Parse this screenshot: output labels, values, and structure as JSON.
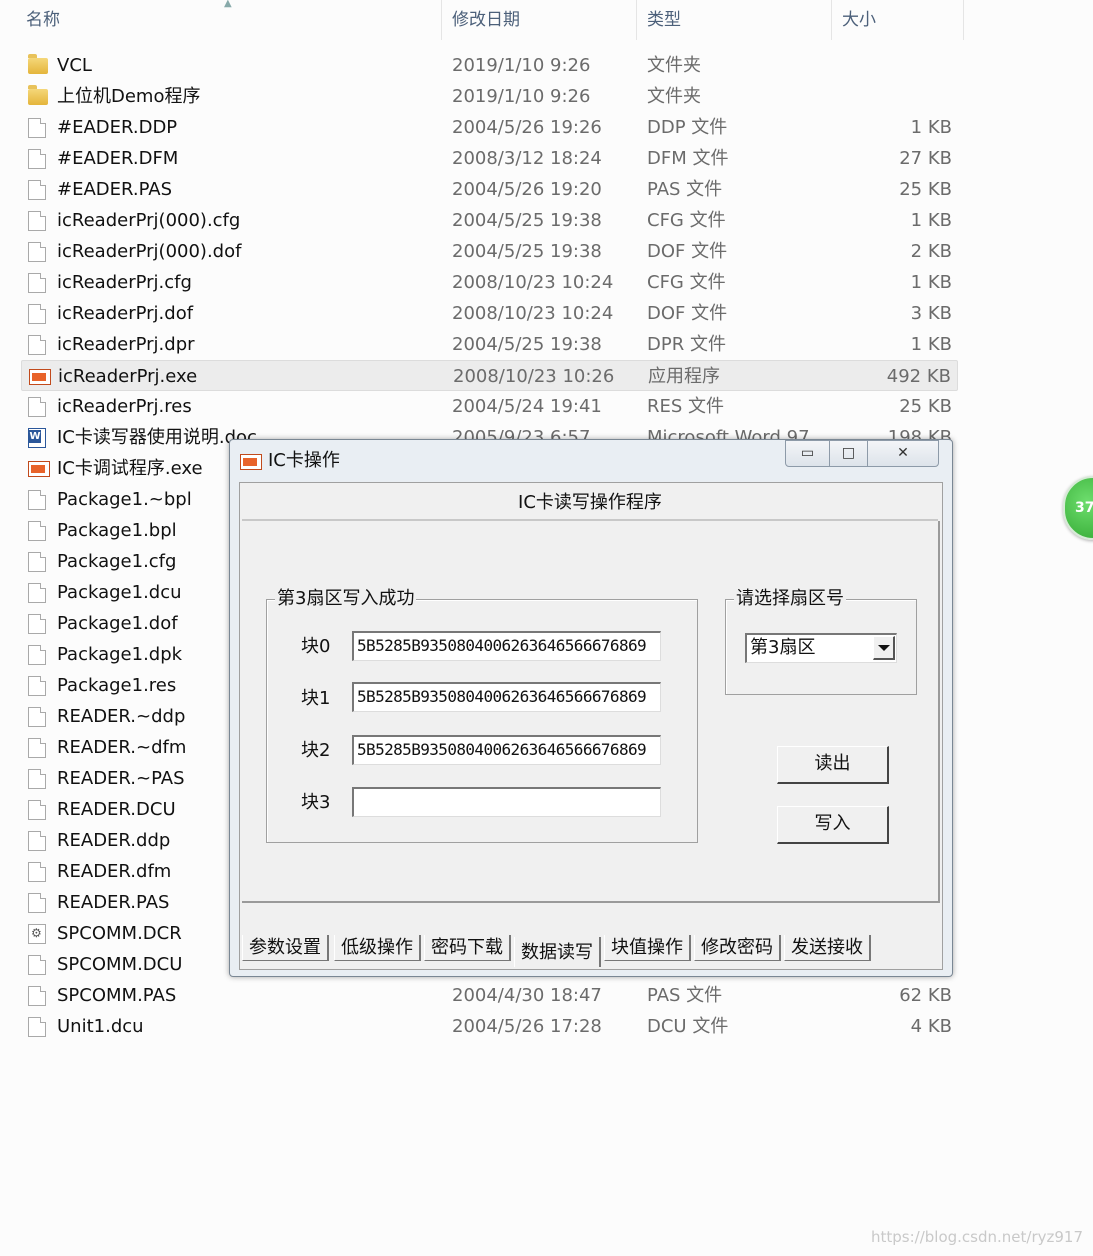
{
  "explorer": {
    "columns": {
      "name": "名称",
      "date": "修改日期",
      "type": "类型",
      "size": "大小"
    },
    "rows": [
      {
        "icon": "folder-icon",
        "name": "VCL",
        "date": "2019/1/10 9:26",
        "type": "文件夹",
        "size": ""
      },
      {
        "icon": "folder-icon",
        "name": "上位机Demo程序",
        "date": "2019/1/10 9:26",
        "type": "文件夹",
        "size": ""
      },
      {
        "icon": "file-icon",
        "name": "#EADER.DDP",
        "date": "2004/5/26 19:26",
        "type": "DDP 文件",
        "size": "1 KB"
      },
      {
        "icon": "file-icon",
        "name": "#EADER.DFM",
        "date": "2008/3/12 18:24",
        "type": "DFM 文件",
        "size": "27 KB"
      },
      {
        "icon": "file-icon",
        "name": "#EADER.PAS",
        "date": "2004/5/26 19:20",
        "type": "PAS 文件",
        "size": "25 KB"
      },
      {
        "icon": "file-icon",
        "name": "icReaderPrj(000).cfg",
        "date": "2004/5/25 19:38",
        "type": "CFG 文件",
        "size": "1 KB"
      },
      {
        "icon": "file-icon",
        "name": "icReaderPrj(000).dof",
        "date": "2004/5/25 19:38",
        "type": "DOF 文件",
        "size": "2 KB"
      },
      {
        "icon": "file-icon",
        "name": "icReaderPrj.cfg",
        "date": "2008/10/23 10:24",
        "type": "CFG 文件",
        "size": "1 KB"
      },
      {
        "icon": "file-icon",
        "name": "icReaderPrj.dof",
        "date": "2008/10/23 10:24",
        "type": "DOF 文件",
        "size": "3 KB"
      },
      {
        "icon": "file-icon",
        "name": "icReaderPrj.dpr",
        "date": "2004/5/25 19:38",
        "type": "DPR 文件",
        "size": "1 KB"
      },
      {
        "icon": "exe-icon",
        "name": "icReaderPrj.exe",
        "date": "2008/10/23 10:26",
        "type": "应用程序",
        "size": "492 KB"
      },
      {
        "icon": "file-icon",
        "name": "icReaderPrj.res",
        "date": "2004/5/24 19:41",
        "type": "RES 文件",
        "size": "25 KB"
      },
      {
        "icon": "word-doc-icon",
        "name": "IC卡读写器使用说明.doc",
        "date": "2005/9/23 6:57",
        "type": "Microsoft Word 97",
        "size": "198 KB"
      },
      {
        "icon": "exe-icon",
        "name": "IC卡调试程序.exe",
        "date": "",
        "type": "",
        "size": ""
      },
      {
        "icon": "file-icon",
        "name": "Package1.~bpl",
        "date": "",
        "type": "",
        "size": ""
      },
      {
        "icon": "file-icon",
        "name": "Package1.bpl",
        "date": "",
        "type": "",
        "size": ""
      },
      {
        "icon": "file-icon",
        "name": "Package1.cfg",
        "date": "",
        "type": "",
        "size": ""
      },
      {
        "icon": "file-icon",
        "name": "Package1.dcu",
        "date": "",
        "type": "",
        "size": ""
      },
      {
        "icon": "file-icon",
        "name": "Package1.dof",
        "date": "",
        "type": "",
        "size": ""
      },
      {
        "icon": "file-icon",
        "name": "Package1.dpk",
        "date": "",
        "type": "",
        "size": ""
      },
      {
        "icon": "file-icon",
        "name": "Package1.res",
        "date": "",
        "type": "",
        "size": ""
      },
      {
        "icon": "file-icon",
        "name": "READER.~ddp",
        "date": "",
        "type": "",
        "size": ""
      },
      {
        "icon": "file-icon",
        "name": "READER.~dfm",
        "date": "",
        "type": "",
        "size": ""
      },
      {
        "icon": "file-icon",
        "name": "READER.~PAS",
        "date": "",
        "type": "",
        "size": ""
      },
      {
        "icon": "file-icon",
        "name": "READER.DCU",
        "date": "",
        "type": "",
        "size": ""
      },
      {
        "icon": "file-icon",
        "name": "READER.ddp",
        "date": "",
        "type": "",
        "size": ""
      },
      {
        "icon": "file-icon",
        "name": "READER.dfm",
        "date": "",
        "type": "",
        "size": ""
      },
      {
        "icon": "file-icon",
        "name": "READER.PAS",
        "date": "",
        "type": "",
        "size": ""
      },
      {
        "icon": "settings-file-icon",
        "name": "SPCOMM.DCR",
        "date": "",
        "type": "",
        "size": ""
      },
      {
        "icon": "file-icon",
        "name": "SPCOMM.DCU",
        "date": "",
        "type": "",
        "size": ""
      },
      {
        "icon": "file-icon",
        "name": "SPCOMM.PAS",
        "date": "2004/4/30 18:47",
        "type": "PAS 文件",
        "size": "62 KB"
      },
      {
        "icon": "file-icon",
        "name": "Unit1.dcu",
        "date": "2004/5/26 17:28",
        "type": "DCU 文件",
        "size": "4 KB"
      }
    ],
    "selected_index": 10
  },
  "dialog": {
    "title": "IC卡操作",
    "controls": {
      "minimize": "▭",
      "maximize": "□",
      "close": "✕"
    },
    "header": "IC卡读写操作程序",
    "write_group": {
      "legend": "第3扇区写入成功",
      "blocks": [
        {
          "label": "块0",
          "value": "5B5285B9350804006263646566676869"
        },
        {
          "label": "块1",
          "value": "5B5285B9350804006263646566676869"
        },
        {
          "label": "块2",
          "value": "5B5285B9350804006263646566676869"
        },
        {
          "label": "块3",
          "value": ""
        }
      ]
    },
    "sector_group": {
      "legend": "请选择扇区号",
      "selected": "第3扇区"
    },
    "buttons": {
      "read": "读出",
      "write": "写入"
    },
    "tabs": [
      "参数设置",
      "低级操作",
      "密码下载",
      "数据读写",
      "块值操作",
      "修改密码",
      "发送接收"
    ],
    "active_tab": 3
  },
  "badge": {
    "text": "37"
  },
  "watermark": "https://blog.csdn.net/ryz917",
  "colors": {
    "selected_row": "#ececec",
    "header_text": "#4c607a",
    "badge": "#2ea52e"
  }
}
